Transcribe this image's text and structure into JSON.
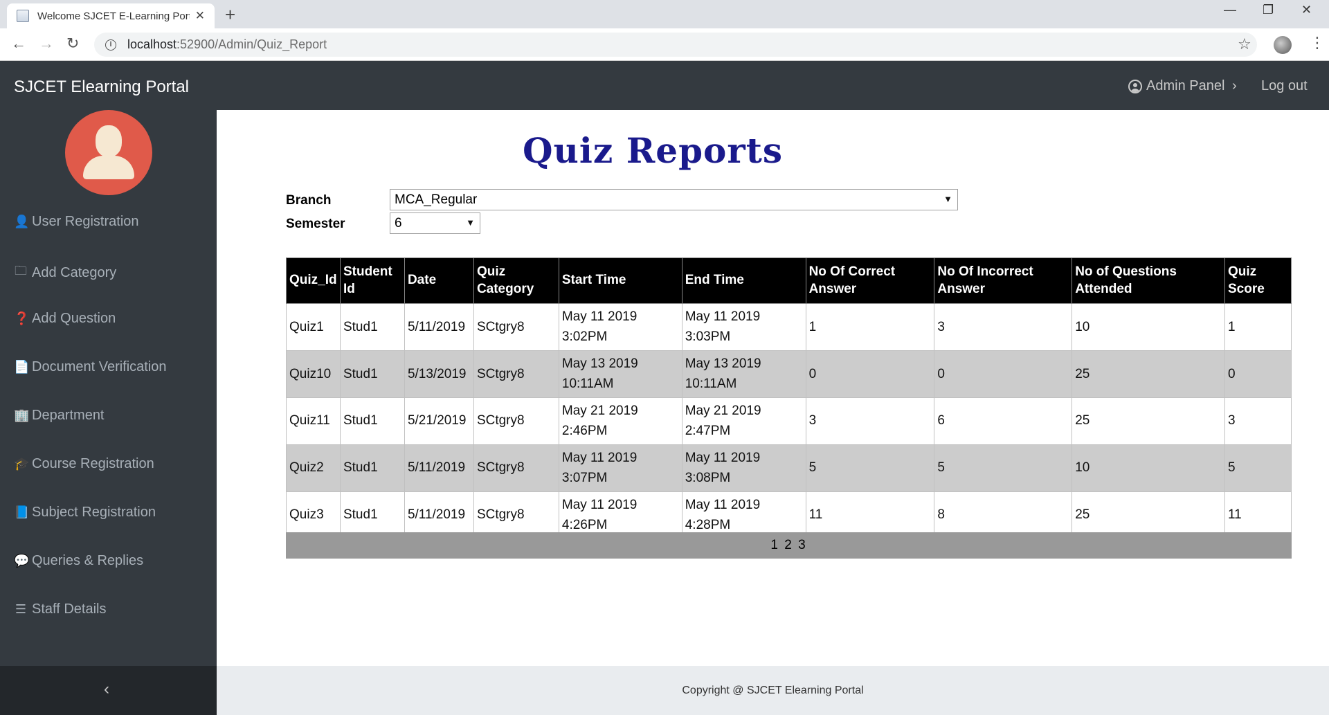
{
  "browser": {
    "tab_title": "Welcome SJCET E-Learning Portal",
    "url_host": "localhost",
    "url_path": ":52900/Admin/Quiz_Report"
  },
  "header": {
    "brand": "SJCET Elearning Portal",
    "admin_panel": "Admin Panel",
    "logout": "Log out"
  },
  "sidebar": {
    "items": [
      {
        "label": "User Registration",
        "icon": "user-plus-icon",
        "glyph": "👤"
      },
      {
        "label": "Add Category",
        "icon": "folder-icon",
        "glyph": "🗀"
      },
      {
        "label": "Add Question",
        "icon": "question-circle-icon",
        "glyph": "❓"
      },
      {
        "label": "Document Verification",
        "icon": "file-icon",
        "glyph": "📄"
      },
      {
        "label": "Department",
        "icon": "building-icon",
        "glyph": "🏢"
      },
      {
        "label": "Course Registration",
        "icon": "graduation-cap-icon",
        "glyph": "🎓"
      },
      {
        "label": "Subject Registration",
        "icon": "book-icon",
        "glyph": "📘"
      },
      {
        "label": "Queries & Replies",
        "icon": "comments-icon",
        "glyph": "💬"
      },
      {
        "label": "Staff Details",
        "icon": "list-icon",
        "glyph": "☰"
      }
    ]
  },
  "main": {
    "title": "Quiz Reports",
    "branch_label": "Branch",
    "branch_value": "MCA_Regular",
    "semester_label": "Semester",
    "semester_value": "6"
  },
  "table": {
    "headers": [
      "Quiz_Id",
      "Student Id",
      "Date",
      "Quiz Category",
      "Start Time",
      "End Time",
      "No Of Correct Answer",
      "No Of Incorrect Answer",
      "No of Questions Attended",
      "Quiz Score"
    ],
    "rows": [
      [
        "Quiz1",
        "Stud1",
        "5/11/2019",
        "SCtgry8",
        "May 11 2019 3:02PM",
        "May 11 2019 3:03PM",
        "1",
        "3",
        "10",
        "1"
      ],
      [
        "Quiz10",
        "Stud1",
        "5/13/2019",
        "SCtgry8",
        "May 13 2019 10:11AM",
        "May 13 2019 10:11AM",
        "0",
        "0",
        "25",
        "0"
      ],
      [
        "Quiz11",
        "Stud1",
        "5/21/2019",
        "SCtgry8",
        "May 21 2019 2:46PM",
        "May 21 2019 2:47PM",
        "3",
        "6",
        "25",
        "3"
      ],
      [
        "Quiz2",
        "Stud1",
        "5/11/2019",
        "SCtgry8",
        "May 11 2019 3:07PM",
        "May 11 2019 3:08PM",
        "5",
        "5",
        "10",
        "5"
      ],
      [
        "Quiz3",
        "Stud1",
        "5/11/2019",
        "SCtgry8",
        "May 11 2019 4:26PM",
        "May 11 2019 4:28PM",
        "11",
        "8",
        "25",
        "11"
      ]
    ],
    "pager": [
      "1",
      "2",
      "3"
    ]
  },
  "footer": {
    "copyright": "Copyright @ SJCET Elearning Portal"
  }
}
